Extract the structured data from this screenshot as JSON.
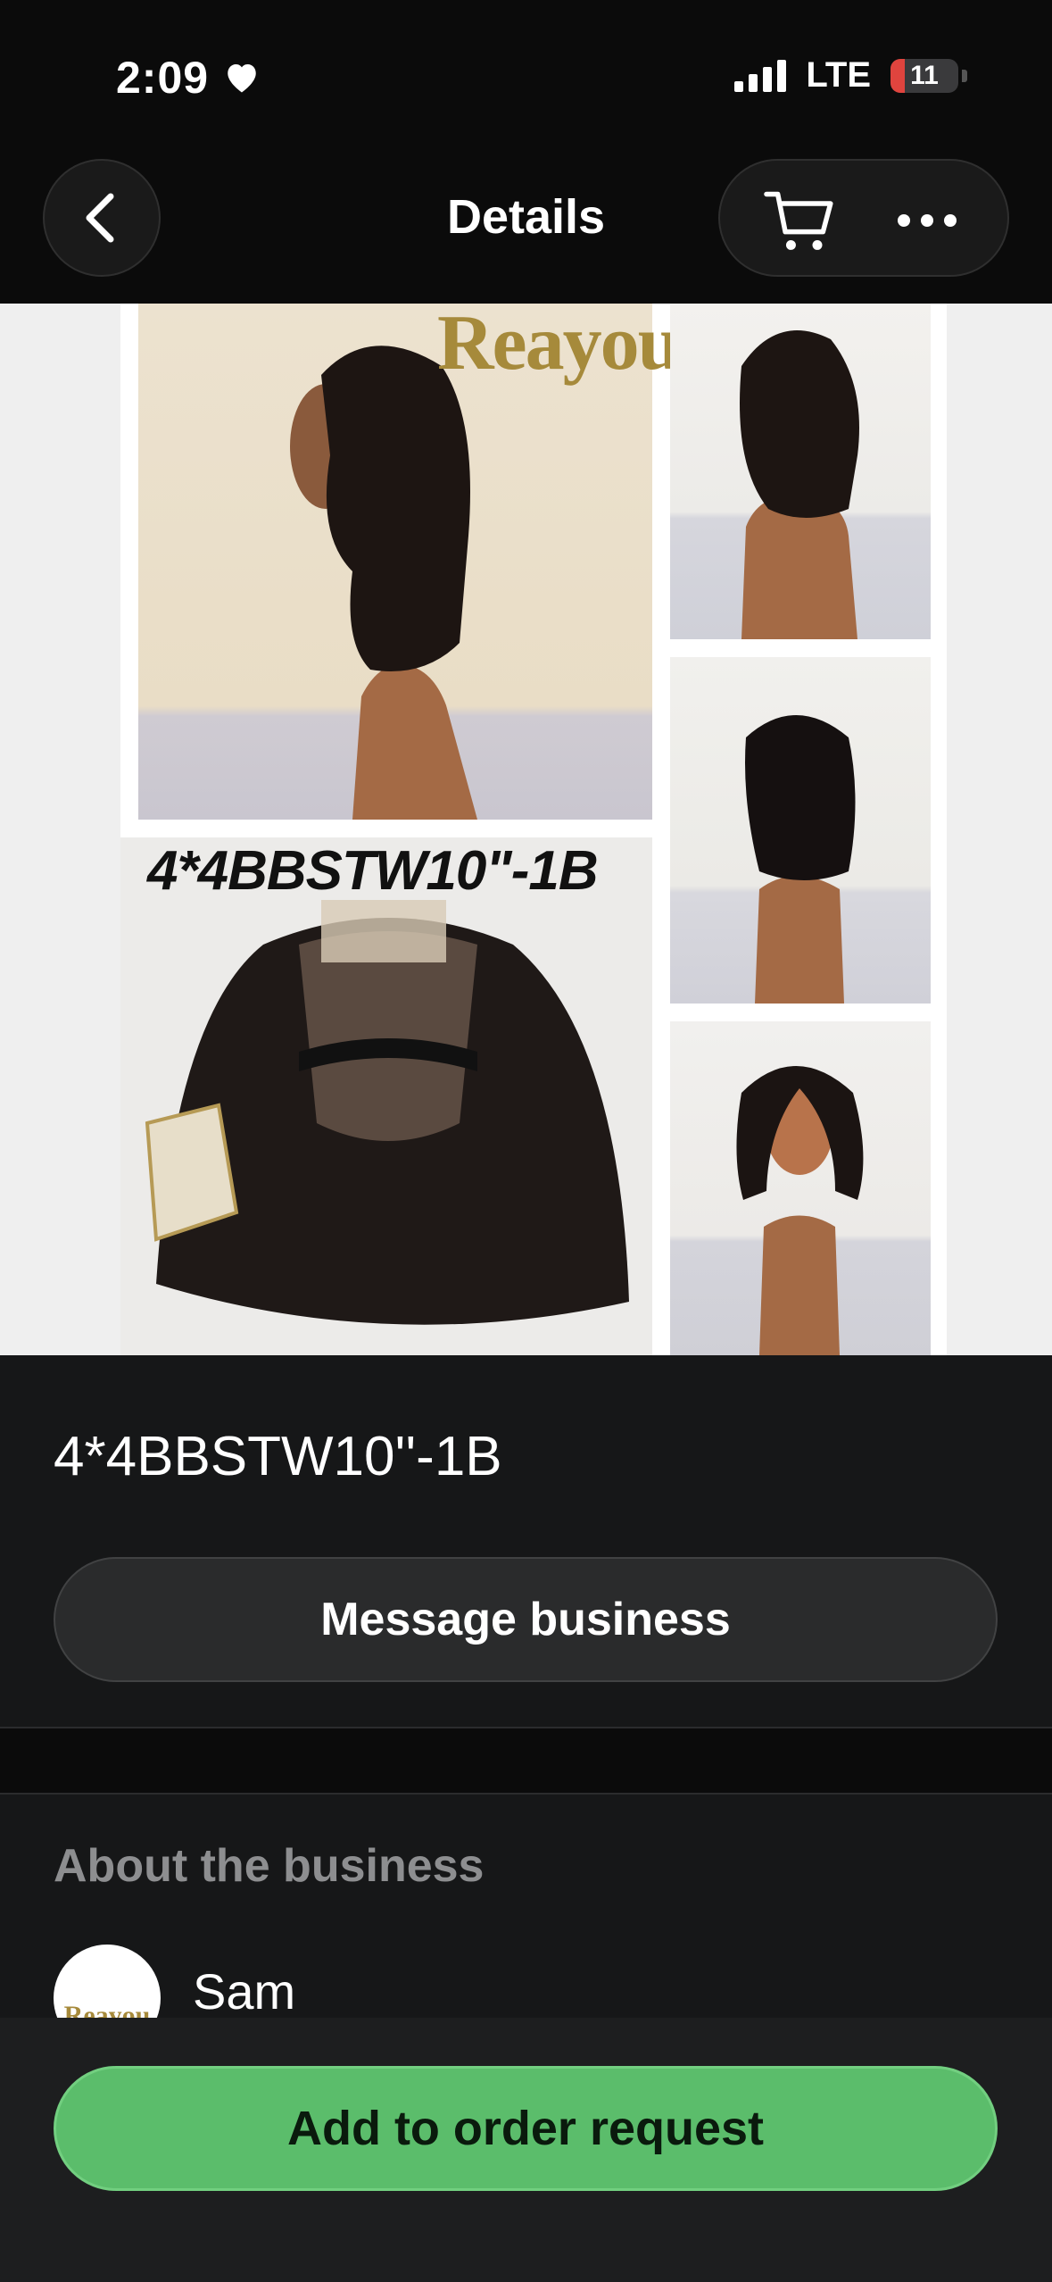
{
  "status_bar": {
    "time": "2:09",
    "network": "LTE",
    "battery": "11",
    "battery_color": "#e0443e"
  },
  "nav": {
    "title": "Details",
    "back_icon": "chevron-left-icon",
    "cart_icon": "cart-icon",
    "more_icon": "more-horizontal-icon"
  },
  "hero": {
    "brand_logo": "Reayou",
    "overlay_code": "4*4BBSTW10\"-1B"
  },
  "product": {
    "title": "4*4BBSTW10''-1B",
    "message_button": "Message business"
  },
  "about": {
    "heading": "About the business",
    "business_name": "Sam",
    "avatar_logo": "Reayou"
  },
  "bottom": {
    "primary_button": "Add to order request",
    "primary_color": "#5bbd6b"
  }
}
